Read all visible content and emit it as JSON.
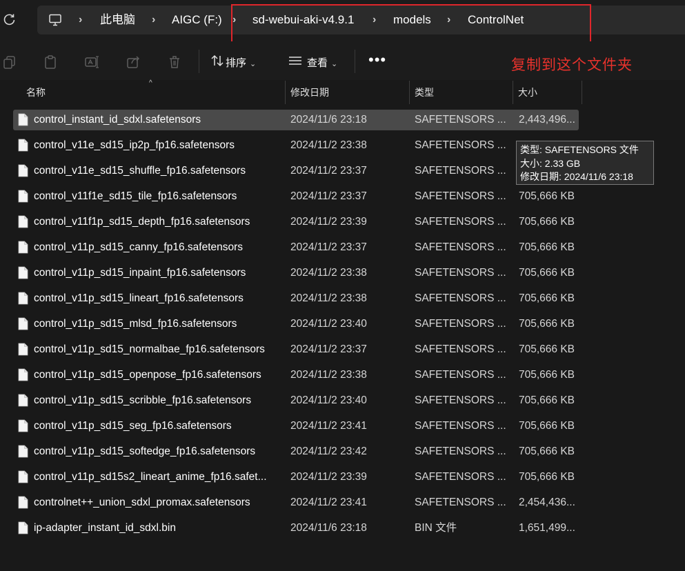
{
  "address_bar": {
    "crumbs": [
      "此电脑",
      "AIGC (F:)",
      "sd-webui-aki-v4.9.1",
      "models",
      "ControlNet"
    ]
  },
  "command_bar": {
    "sort_label": "排序",
    "view_label": "查看",
    "more_label": "•••",
    "icons": [
      "copy-icon",
      "paste-icon",
      "rename-icon",
      "share-icon",
      "delete-icon",
      "sort-icon",
      "view-icon"
    ]
  },
  "annotation": "复制到这个文件夹",
  "columns": {
    "name": "名称",
    "date": "修改日期",
    "type": "类型",
    "size": "大小"
  },
  "files": [
    {
      "name": "control_instant_id_sdxl.safetensors",
      "date": "2024/11/6 23:18",
      "type": "SAFETENSORS ...",
      "size": "2,443,496...",
      "selected": true
    },
    {
      "name": "control_v11e_sd15_ip2p_fp16.safetensors",
      "date": "2024/11/2 23:38",
      "type": "SAFETENSORS ...",
      "size": ""
    },
    {
      "name": "control_v11e_sd15_shuffle_fp16.safetensors",
      "date": "2024/11/2 23:37",
      "type": "SAFETENSORS ...",
      "size": ""
    },
    {
      "name": "control_v11f1e_sd15_tile_fp16.safetensors",
      "date": "2024/11/2 23:37",
      "type": "SAFETENSORS ...",
      "size": "705,666 KB"
    },
    {
      "name": "control_v11f1p_sd15_depth_fp16.safetensors",
      "date": "2024/11/2 23:39",
      "type": "SAFETENSORS ...",
      "size": "705,666 KB"
    },
    {
      "name": "control_v11p_sd15_canny_fp16.safetensors",
      "date": "2024/11/2 23:37",
      "type": "SAFETENSORS ...",
      "size": "705,666 KB"
    },
    {
      "name": "control_v11p_sd15_inpaint_fp16.safetensors",
      "date": "2024/11/2 23:38",
      "type": "SAFETENSORS ...",
      "size": "705,666 KB"
    },
    {
      "name": "control_v11p_sd15_lineart_fp16.safetensors",
      "date": "2024/11/2 23:38",
      "type": "SAFETENSORS ...",
      "size": "705,666 KB"
    },
    {
      "name": "control_v11p_sd15_mlsd_fp16.safetensors",
      "date": "2024/11/2 23:40",
      "type": "SAFETENSORS ...",
      "size": "705,666 KB"
    },
    {
      "name": "control_v11p_sd15_normalbae_fp16.safetensors",
      "date": "2024/11/2 23:37",
      "type": "SAFETENSORS ...",
      "size": "705,666 KB"
    },
    {
      "name": "control_v11p_sd15_openpose_fp16.safetensors",
      "date": "2024/11/2 23:38",
      "type": "SAFETENSORS ...",
      "size": "705,666 KB"
    },
    {
      "name": "control_v11p_sd15_scribble_fp16.safetensors",
      "date": "2024/11/2 23:40",
      "type": "SAFETENSORS ...",
      "size": "705,666 KB"
    },
    {
      "name": "control_v11p_sd15_seg_fp16.safetensors",
      "date": "2024/11/2 23:41",
      "type": "SAFETENSORS ...",
      "size": "705,666 KB"
    },
    {
      "name": "control_v11p_sd15_softedge_fp16.safetensors",
      "date": "2024/11/2 23:42",
      "type": "SAFETENSORS ...",
      "size": "705,666 KB"
    },
    {
      "name": "control_v11p_sd15s2_lineart_anime_fp16.safet...",
      "date": "2024/11/2 23:39",
      "type": "SAFETENSORS ...",
      "size": "705,666 KB"
    },
    {
      "name": "controlnet++_union_sdxl_promax.safetensors",
      "date": "2024/11/2 23:41",
      "type": "SAFETENSORS ...",
      "size": "2,454,436..."
    },
    {
      "name": "ip-adapter_instant_id_sdxl.bin",
      "date": "2024/11/6 23:18",
      "type": "BIN 文件",
      "size": "1,651,499..."
    }
  ],
  "tooltip": {
    "type_line": "类型: SAFETENSORS 文件",
    "size_line": "大小: 2.33 GB",
    "date_line": "修改日期: 2024/11/6 23:18"
  },
  "colors": {
    "background": "#191919",
    "selected_row": "#4a4a4a",
    "highlight": "#e0262b",
    "annotation": "#e8322c"
  }
}
